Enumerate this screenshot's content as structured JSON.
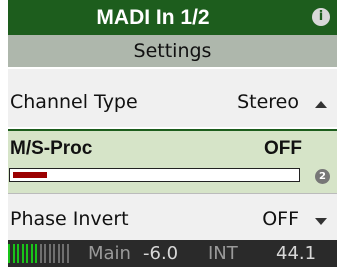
{
  "header": {
    "title": "MADI In 1/2",
    "info_glyph": "i",
    "info_icon": "info-icon"
  },
  "settings_label": "Settings",
  "channel_type": {
    "label": "Channel Type",
    "value": "Stereo",
    "arrow_icon": "arrow-up-icon"
  },
  "ms_proc": {
    "label": "M/S-Proc",
    "value": "OFF",
    "level": 0.12,
    "knob_glyph": "2",
    "knob_icon": "knob-icon"
  },
  "phase_invert": {
    "label": "Phase Invert",
    "value": "OFF",
    "arrow_icon": "arrow-down-icon"
  },
  "status": {
    "main": "Main",
    "level": "-6.0",
    "clock": "INT",
    "rate": "44.1"
  },
  "colors": {
    "title_bg": "#1d5d1d",
    "settings_bg": "#aeb7ac",
    "row_bg": "#f0f0f0",
    "selected_bg": "#d6e4c8",
    "bar_fill": "#9b0000",
    "status_bg": "#2a2a2a",
    "meter_green": "#19c419",
    "meter_gray": "#6f6f6f"
  }
}
